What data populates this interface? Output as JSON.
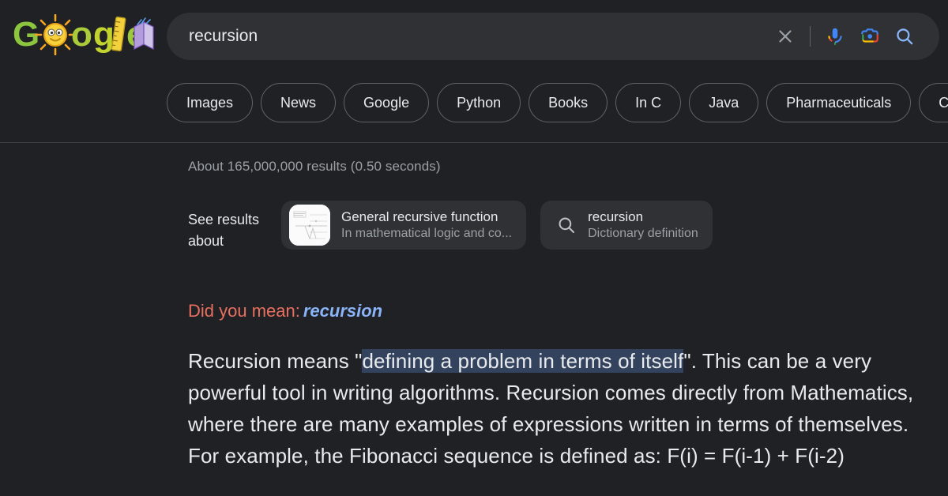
{
  "theme": {
    "background": "#202124",
    "surface": "#303134",
    "text_primary": "#e8eaed",
    "text_secondary": "#9aa0a6",
    "border": "#5f6368",
    "divider": "#3c4043",
    "accent_blue": "#8ab4f8",
    "accent_red": "#e8705f",
    "selection_bg": "#33435e"
  },
  "header": {
    "logo": {
      "name": "google-doodle-logo",
      "text": "Google",
      "doodle_elements": [
        "sun",
        "ruler",
        "book"
      ],
      "colors": [
        "#9ccc3c",
        "#c6d934",
        "#f0c419",
        "#b39ddb"
      ]
    },
    "search": {
      "value": "recursion",
      "placeholder": "Search",
      "clear_label": "Clear",
      "voice_label": "Search by voice",
      "lens_label": "Search by image",
      "submit_label": "Google Search"
    },
    "chips": [
      {
        "label": "Images"
      },
      {
        "label": "News"
      },
      {
        "label": "Google"
      },
      {
        "label": "Python"
      },
      {
        "label": "Books"
      },
      {
        "label": "In C"
      },
      {
        "label": "Java"
      },
      {
        "label": "Pharmaceuticals"
      },
      {
        "label": "C++"
      }
    ]
  },
  "main": {
    "results_count": "About 165,000,000 results (0.50 seconds)",
    "see_results": {
      "label": "See results about",
      "cards": [
        {
          "icon": "diagram-thumbnail",
          "title": "General recursive function",
          "subtitle": "In mathematical logic and co..."
        },
        {
          "icon": "search-icon",
          "title": "recursion",
          "subtitle": "Dictionary definition"
        }
      ]
    },
    "did_you_mean": {
      "label": "Did you mean:",
      "suggestion": "recursion"
    },
    "answer": {
      "before_selection": "Recursion means \"",
      "selection": "defining a problem in terms of itself",
      "after_selection": "\". This can be a very powerful tool in writing algorithms. Recursion comes directly from Mathematics, where there are many examples of expressions written in terms of themselves. For example, the Fibonacci sequence is defined as: F(i) = F(i-1) + F(i-2)"
    }
  }
}
